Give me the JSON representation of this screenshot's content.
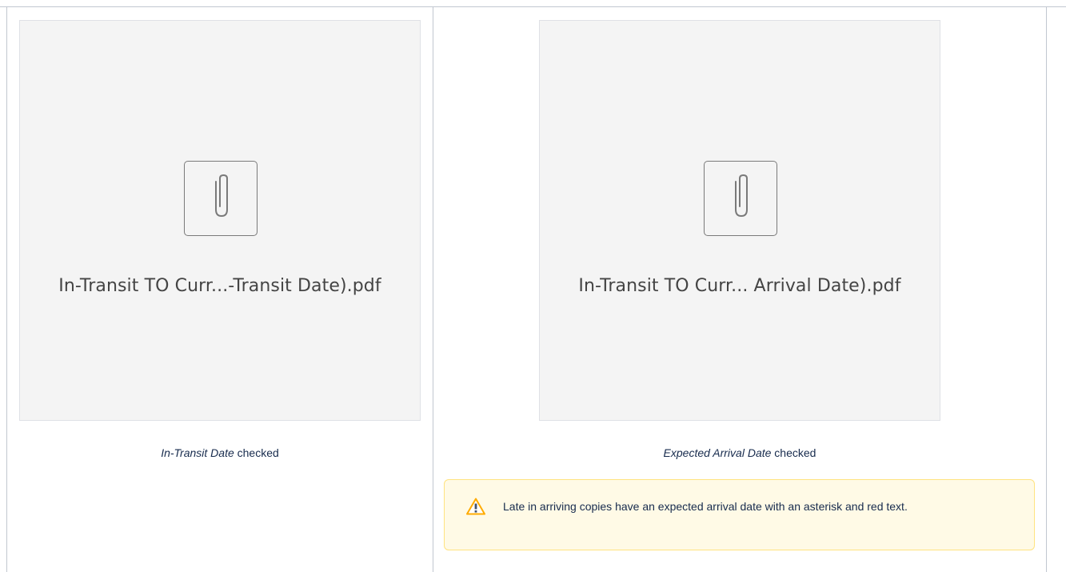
{
  "cells": [
    {
      "filename": "In-Transit TO Curr...-Transit Date).pdf",
      "caption_emphasis": "In-Transit Date",
      "caption_rest": " checked",
      "icon": "paperclip-icon"
    },
    {
      "filename": "In-Transit TO Curr... Arrival Date).pdf",
      "caption_emphasis": "Expected Arrival Date",
      "caption_rest": " checked",
      "icon": "paperclip-icon"
    }
  ],
  "warning": {
    "icon": "warning-icon",
    "text": "Late in arriving copies have an expected arrival date with an asterisk and red text.",
    "colors": {
      "background": "#fffae6",
      "border": "#ffe380",
      "icon": "#ffab00"
    }
  },
  "colors": {
    "border": "#c1c7d0",
    "attachment_bg": "#f4f4f4"
  }
}
